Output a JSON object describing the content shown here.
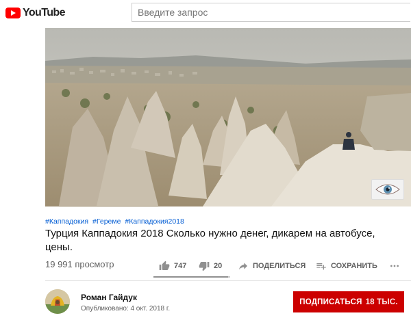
{
  "masthead": {
    "logo_text": "YouTube",
    "brand_color": "#ff0000",
    "search": {
      "placeholder": "Введите запрос",
      "value": ""
    }
  },
  "video": {
    "hashtags": [
      "#Каппадокия",
      "#Гереме",
      "#Каппадокия2018"
    ],
    "title": "Турция Каппадокия 2018 Сколько нужно денег, дикарем на автобусе, цены.",
    "views": "19 991 просмотр"
  },
  "actions": {
    "like_count": "747",
    "dislike_count": "20",
    "share_label": "ПОДЕЛИТЬСЯ",
    "save_label": "СОХРАНИТЬ",
    "like_fraction": 0.974
  },
  "channel": {
    "name": "Роман Гайдук",
    "published": "Опубликовано: 4 окт. 2018 г.",
    "subscribe_label": "ПОДПИСАТЬСЯ",
    "subscriber_count": "18 ТЫС.",
    "subscribe_color": "#cc0000"
  },
  "icons": {
    "logo": "youtube-logo-icon",
    "like": "thumbs-up-icon",
    "dislike": "thumbs-down-icon",
    "share": "share-arrow-icon",
    "save": "add-to-playlist-icon",
    "more": "more-horizontal-icon",
    "player_badge": "eye-icon"
  }
}
